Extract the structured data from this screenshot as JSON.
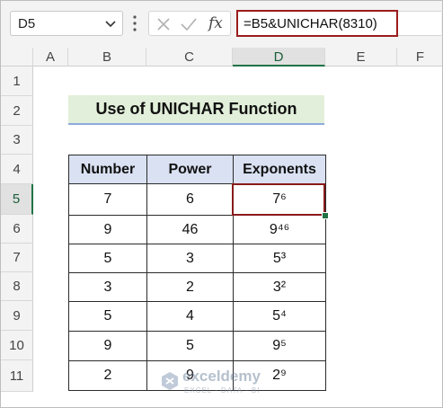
{
  "formula_bar": {
    "name_box": "D5",
    "fx_label": "fx",
    "formula": "=B5&UNICHAR(8310)"
  },
  "columns": [
    "A",
    "B",
    "C",
    "D",
    "E",
    "F"
  ],
  "active_column": "D",
  "rows": [
    "1",
    "2",
    "3",
    "4",
    "5",
    "6",
    "7",
    "8",
    "9",
    "10",
    "11"
  ],
  "active_row": "5",
  "sheet": {
    "title": "Use of UNICHAR Function",
    "headers": [
      "Number",
      "Power",
      "Exponents"
    ],
    "data": [
      {
        "number": "7",
        "power": "6",
        "exponent": "7⁶"
      },
      {
        "number": "9",
        "power": "46",
        "exponent": "9⁴⁶"
      },
      {
        "number": "5",
        "power": "3",
        "exponent": "5³"
      },
      {
        "number": "3",
        "power": "2",
        "exponent": "3²"
      },
      {
        "number": "5",
        "power": "4",
        "exponent": "5⁴"
      },
      {
        "number": "9",
        "power": "5",
        "exponent": "9⁵"
      },
      {
        "number": "2",
        "power": "9",
        "exponent": "2⁹"
      }
    ]
  },
  "watermark": {
    "name": "exceldemy",
    "tagline": "EXCEL · DATA · BI"
  },
  "colors": {
    "selection": "#8b1a1a",
    "header_fill": "#d9e1f2",
    "title_fill": "#e2efda",
    "accent": "#217346"
  }
}
